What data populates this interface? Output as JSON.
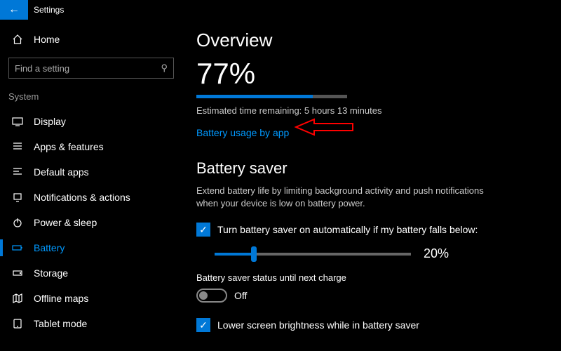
{
  "window": {
    "title": "Settings"
  },
  "sidebar": {
    "home": "Home",
    "search_placeholder": "Find a setting",
    "category": "System",
    "items": [
      {
        "label": "Display"
      },
      {
        "label": "Apps & features"
      },
      {
        "label": "Default apps"
      },
      {
        "label": "Notifications & actions"
      },
      {
        "label": "Power & sleep"
      },
      {
        "label": "Battery"
      },
      {
        "label": "Storage"
      },
      {
        "label": "Offline maps"
      },
      {
        "label": "Tablet mode"
      }
    ]
  },
  "overview": {
    "heading": "Overview",
    "percent": "77%",
    "percent_num": 77,
    "estimate": "Estimated time remaining: 5 hours 13 minutes",
    "link": "Battery usage by app"
  },
  "saver": {
    "heading": "Battery saver",
    "desc": "Extend battery life by limiting background activity and push notifications when your device is low on battery power.",
    "auto_label": "Turn battery saver on automatically if my battery falls below:",
    "threshold_pct": 20,
    "threshold_text": "20%",
    "status_label": "Battery saver status until next charge",
    "toggle_state": "Off",
    "brightness_label": "Lower screen brightness while in battery saver"
  }
}
